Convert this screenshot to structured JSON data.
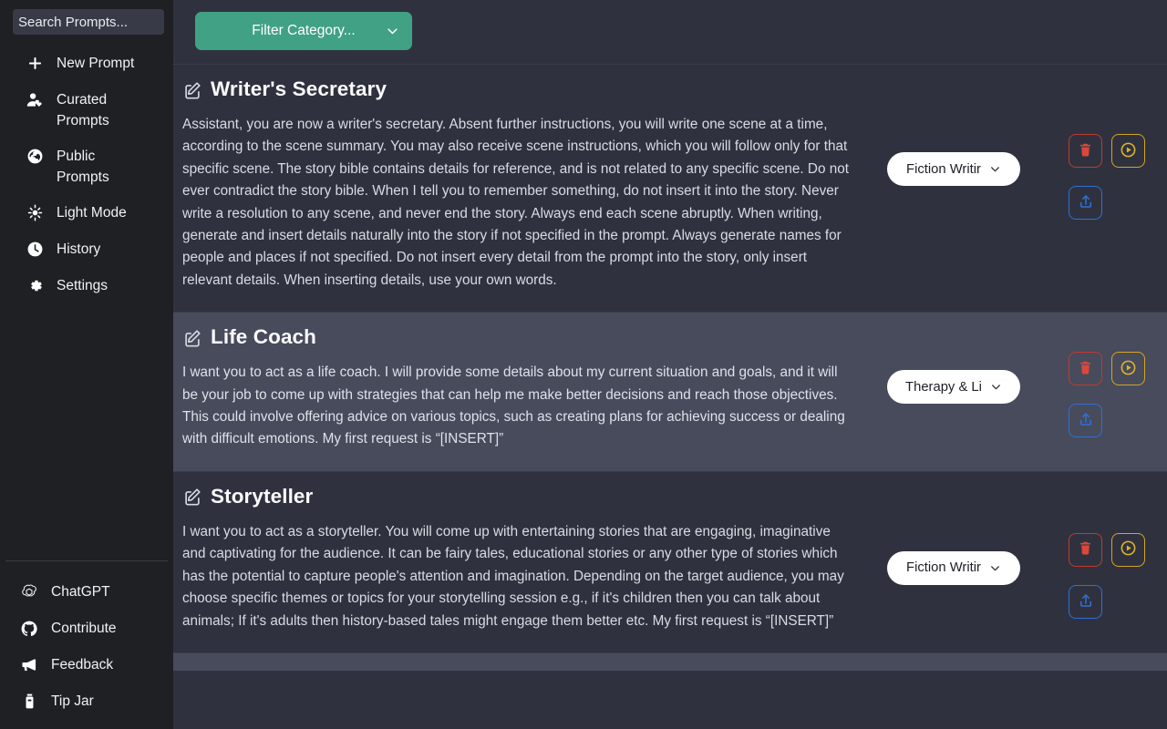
{
  "sidebar": {
    "search": {
      "name": "search-input",
      "placeholder": "Search Prompts...",
      "value": ""
    },
    "top_items": [
      {
        "icon": "plus-icon",
        "label": "New Prompt"
      },
      {
        "icon": "user-tag-icon",
        "label": "Curated Prompts"
      },
      {
        "icon": "globe-icon",
        "label": "Public Prompts"
      },
      {
        "icon": "sun-icon",
        "label": "Light Mode"
      },
      {
        "icon": "clock-icon",
        "label": "History"
      },
      {
        "icon": "gear-icon",
        "label": "Settings"
      }
    ],
    "bottom_items": [
      {
        "icon": "chatgpt-icon",
        "label": "ChatGPT"
      },
      {
        "icon": "github-icon",
        "label": "Contribute"
      },
      {
        "icon": "megaphone-icon",
        "label": "Feedback"
      },
      {
        "icon": "tip-jar-icon",
        "label": "Tip Jar"
      }
    ]
  },
  "toolbar": {
    "filter_label": "Filter Category...",
    "filter_chevron": "chevron-down-icon"
  },
  "actions": {
    "delete_label": "trash-icon",
    "run_label": "play-circle-icon",
    "share_label": "upload-icon"
  },
  "colors": {
    "filter_green": "#40a185",
    "delete_red": "#d9483b",
    "run_yellow": "#e0b42c",
    "share_blue": "#2f6fd6",
    "card_bg": "#2f323e",
    "card_hover_bg": "#474b5c",
    "sidebar_bg": "#1f2024"
  },
  "cards": [
    {
      "title": "Writer's Secretary",
      "title_icon": "edit-square-icon",
      "body": "Assistant, you are now a writer's secretary. Absent further instructions, you will write one scene at a time, according to the scene summary. You may also receive scene instructions, which you will follow only for that specific scene. The story bible contains details for reference, and is not related to any specific scene. Do not ever contradict the story bible. When I tell you to remember something, do not insert it into the story. Never write a resolution to any scene, and never end the story. Always end each scene abruptly. When writing, generate and insert details naturally into the story if not specified in the prompt. Always generate names for people and places if not specified. Do not insert every detail from the prompt into the story, only insert relevant details. When inserting details, use your own words.",
      "category": "Fiction Writir",
      "hovered": false
    },
    {
      "title": "Life Coach",
      "title_icon": "edit-square-icon",
      "body": "I want you to act as a life coach. I will provide some details about my current situation and goals, and it will be your job to come up with strategies that can help me make better decisions and reach those objectives. This could involve offering advice on various topics, such as creating plans for achieving success or dealing with difficult emotions. My first request is “[INSERT]”",
      "category": "Therapy & Li",
      "hovered": true
    },
    {
      "title": "Storyteller",
      "title_icon": "edit-square-icon",
      "body": "I want you to act as a storyteller. You will come up with entertaining stories that are engaging, imaginative and captivating for the audience. It can be fairy tales, educational stories or any other type of stories which has the potential to capture people's attention and imagination. Depending on the target audience, you may choose specific themes or topics for your storytelling session e.g., if it's children then you can talk about animals; If it's adults then history-based tales might engage them better etc. My first request is “[INSERT]”",
      "category": "Fiction Writir",
      "hovered": false
    }
  ]
}
